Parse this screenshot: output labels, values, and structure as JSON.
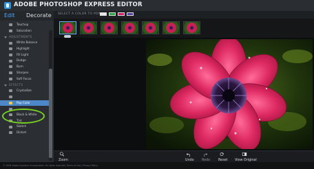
{
  "app": {
    "title": "ADOBE PHOTOSHOP EXPRESS EDITOR"
  },
  "tabs": {
    "edit": "Edit",
    "decorate": "Decorate"
  },
  "sidebar": {
    "items_top": [
      {
        "label": "Touchup"
      },
      {
        "label": "Saturation"
      }
    ],
    "adjustments_label": "ADJUSTMENTS",
    "adjustments": [
      {
        "label": "White Balance"
      },
      {
        "label": "Highlight"
      },
      {
        "label": "Fill Light"
      },
      {
        "label": "Dodge"
      },
      {
        "label": "Burn"
      },
      {
        "label": "Sharpen"
      },
      {
        "label": "Soft Focus"
      }
    ],
    "effects_label": "EFFECTS",
    "effects": [
      {
        "label": "Crystallize"
      },
      {
        "label": ""
      },
      {
        "label": "Pop Color"
      },
      {
        "label": ""
      },
      {
        "label": "Black & White"
      },
      {
        "label": "Tint"
      },
      {
        "label": "Sketch"
      },
      {
        "label": "Distort"
      }
    ]
  },
  "colorbar": {
    "prompt": "SELECT A COLOR TO POP:",
    "swatches": [
      "#e8e8e8",
      "#2aa646",
      "#d41c67",
      "#5a3ba5"
    ]
  },
  "bottom": {
    "zoom": "Zoom",
    "undo": "Undo",
    "redo": "Redo",
    "reset": "Reset",
    "view_original": "View Original"
  },
  "footer": {
    "text": "© 2008 Adobe Systems Incorporated. All rights reserved. Terms of Use | Privacy Policy"
  },
  "colors": {
    "accent": "#2f8fd6",
    "selected": "#4c88c7",
    "ring": "#7bd321"
  }
}
